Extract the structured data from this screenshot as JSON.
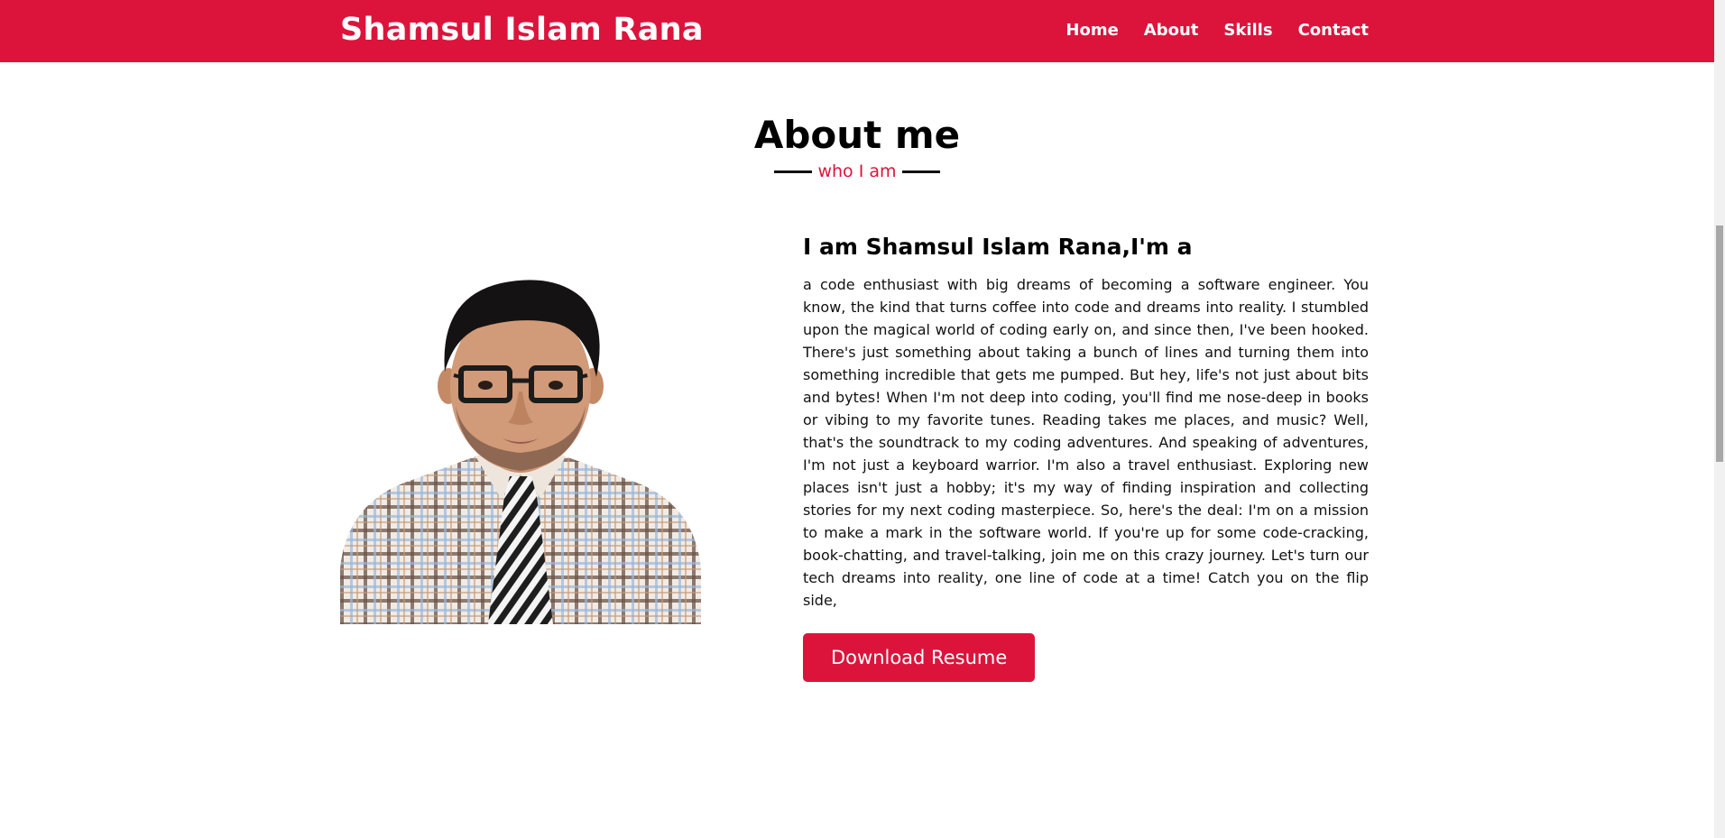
{
  "nav": {
    "brand": "Shamsul Islam Rana",
    "links": [
      {
        "label": "Home"
      },
      {
        "label": "About"
      },
      {
        "label": "Skills"
      },
      {
        "label": "Contact"
      }
    ]
  },
  "about": {
    "title": "About me",
    "subtitle": "who I am",
    "intro": "I am Shamsul Islam Rana,I'm a",
    "bio": "a code enthusiast with big dreams of becoming a software engineer. You know, the kind that turns coffee into code and dreams into reality. I stumbled upon the magical world of coding early on, and since then, I've been hooked. There's just something about taking a bunch of lines and turning them into something incredible that gets me pumped. But hey, life's not just about bits and bytes! When I'm not deep into coding, you'll find me nose-deep in books or vibing to my favorite tunes. Reading takes me places, and music? Well, that's the soundtrack to my coding adventures. And speaking of adventures, I'm not just a keyboard warrior. I'm also a travel enthusiast. Exploring new places isn't just a hobby; it's my way of finding inspiration and collecting stories for my next coding masterpiece. So, here's the deal: I'm on a mission to make a mark in the software world. If you're up for some code-cracking, book-chatting, and travel-talking, join me on this crazy journey. Let's turn our tech dreams into reality, one line of code at a time! Catch you on the flip side,",
    "button_label": "Download Resume"
  },
  "colors": {
    "accent": "#dc143c",
    "text": "#111111",
    "background": "#ffffff"
  }
}
